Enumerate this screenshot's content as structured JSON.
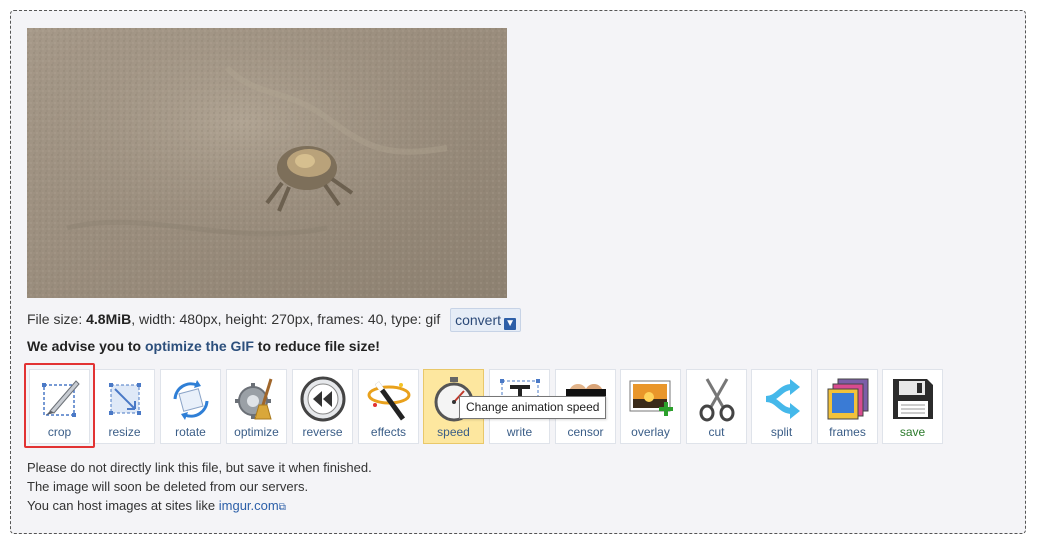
{
  "file_info": {
    "prefix": "File size: ",
    "size": "4.8MiB",
    "details": ", width: 480px, height: 270px, frames: 40, type: gif",
    "convert_label": "convert"
  },
  "advise": {
    "pre": "We advise you to ",
    "link": "optimize the GIF",
    "post": " to reduce file size!"
  },
  "tools": [
    {
      "label": "crop",
      "icon": "crop-icon"
    },
    {
      "label": "resize",
      "icon": "resize-icon"
    },
    {
      "label": "rotate",
      "icon": "rotate-icon"
    },
    {
      "label": "optimize",
      "icon": "optimize-icon"
    },
    {
      "label": "reverse",
      "icon": "reverse-icon"
    },
    {
      "label": "effects",
      "icon": "effects-icon"
    },
    {
      "label": "speed",
      "icon": "stopwatch-icon"
    },
    {
      "label": "write",
      "icon": "write-icon"
    },
    {
      "label": "censor",
      "icon": "censor-icon"
    },
    {
      "label": "overlay",
      "icon": "overlay-icon"
    },
    {
      "label": "cut",
      "icon": "scissors-icon"
    },
    {
      "label": "split",
      "icon": "split-icon"
    },
    {
      "label": "frames",
      "icon": "frames-icon"
    },
    {
      "label": "save",
      "icon": "save-icon"
    }
  ],
  "tooltip": "Change animation speed",
  "notes": {
    "line1": "Please do not directly link this file, but save it when finished.",
    "line2": "The image will soon be deleted from our servers.",
    "line3_pre": "You can host images at sites like ",
    "line3_link": "imgur.com"
  },
  "colors": {
    "panel_bg": "#f4f4f7",
    "active_tool": "#fde79f",
    "highlight": "#e23333",
    "link": "#2c4f7c"
  }
}
